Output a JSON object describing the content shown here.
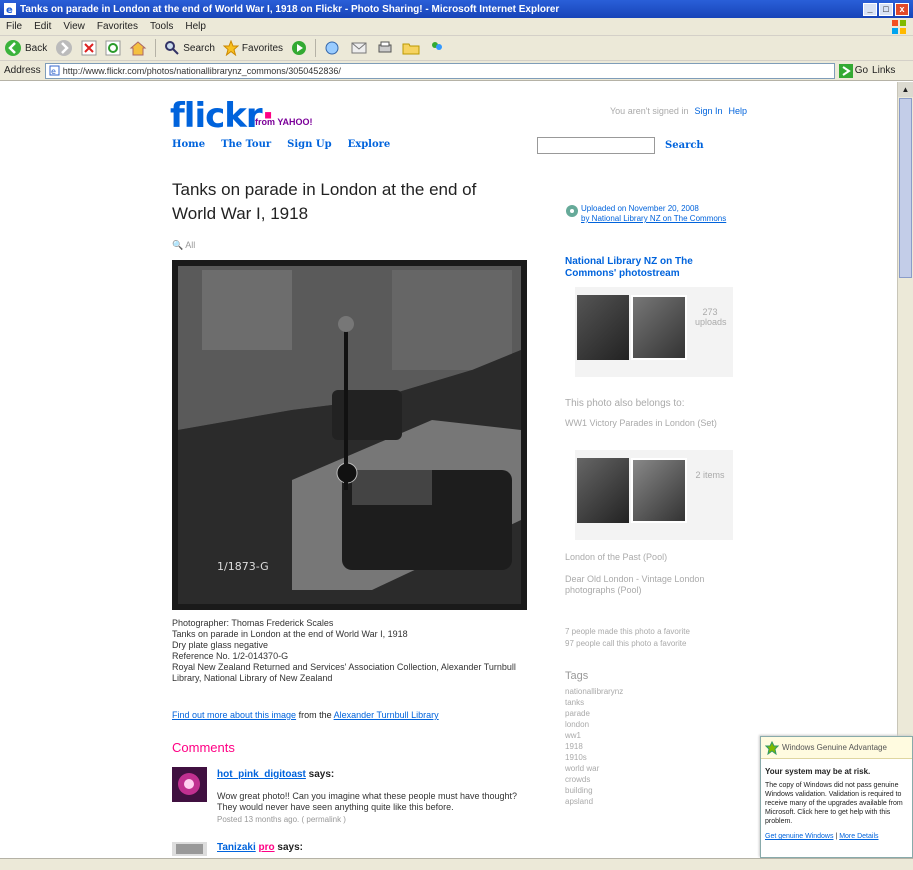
{
  "window": {
    "title": "Tanks on parade in London at the end of World War I, 1918 on Flickr - Photo Sharing! - Microsoft Internet Explorer",
    "controls": [
      "_",
      "□",
      "x"
    ]
  },
  "menubar": [
    "File",
    "Edit",
    "View",
    "Favorites",
    "Tools",
    "Help"
  ],
  "toolbar": {
    "back": "Back",
    "search": "Search",
    "favorites": "Favorites"
  },
  "addressbar": {
    "label": "Address",
    "url": "http://www.flickr.com/photos/nationallibrarynz_commons/3050452836/",
    "go": "Go",
    "links": "Links"
  },
  "flickr": {
    "logo_main": "flickr",
    "logo_dot": "·",
    "logo_sub": "from YAHOO!",
    "nav": [
      "Home",
      "The Tour",
      "Sign Up",
      "Explore"
    ],
    "toplinks": [
      "You aren't signed in",
      "Sign In",
      "Help"
    ],
    "search_button": "Search"
  },
  "photo": {
    "title": "Tanks on parade in London at the end of World War I, 1918",
    "tools": "🔍 All",
    "negative_label": "1/1873-G"
  },
  "caption": [
    "Photographer: Thomas Frederick Scales",
    "Tanks on parade in London at the end of World War I, 1918",
    "Dry plate glass negative",
    "Reference No. 1/2-014370-G",
    "Royal New Zealand Returned and Services' Association Collection, Alexander Turnbull",
    "Library, National Library of New Zealand"
  ],
  "findout": {
    "link1": "Find out more about this image",
    "mid": " from the ",
    "link2": "Alexander Turnbull Library"
  },
  "comments": {
    "heading": "Comments",
    "items": [
      {
        "name": "hot_pink_digitoast",
        "says": " says:",
        "text": "Wow great photo!! Can you imagine what these people must have thought? They would never have seen anything quite like this before.",
        "meta": "Posted 13 months ago. ( permalink )"
      },
      {
        "name": "Tanizaki",
        "pro": "pro",
        "says": " says:"
      }
    ]
  },
  "sidebar": {
    "uploaded_prefix": "Uploaded on November 20, 2008",
    "uploaded_by": "by National Library NZ on The Commons",
    "stream_title": "National Library NZ on The Commons' photostream",
    "stream_count": "273 uploads",
    "belongs": "This photo also belongs to:",
    "set_title": "WW1 Victory Parades in London (Set)",
    "set_count": "2 items",
    "group1": "London of the Past (Pool)",
    "group2": "Dear Old London - Vintage London photographs (Pool)",
    "people": [
      "7 people made this photo a favorite",
      "97 people call this photo a favorite"
    ],
    "tags_heading": "Tags",
    "tags": [
      "nationallibrarynz",
      "tanks",
      "parade",
      "london",
      "ww1",
      "1918",
      "1910s",
      "world war",
      "crowds",
      "building",
      "apsland"
    ]
  },
  "wga": {
    "head": "Windows Genuine Advantage",
    "bold": "Your system may be at risk.",
    "body": "The copy of Windows did not pass genuine Windows validation. Validation is required to receive many of the upgrades available from Microsoft. Click here to get help with this problem.",
    "link1": "Get genuine Windows",
    "sep": " | ",
    "link2": "More Details"
  }
}
